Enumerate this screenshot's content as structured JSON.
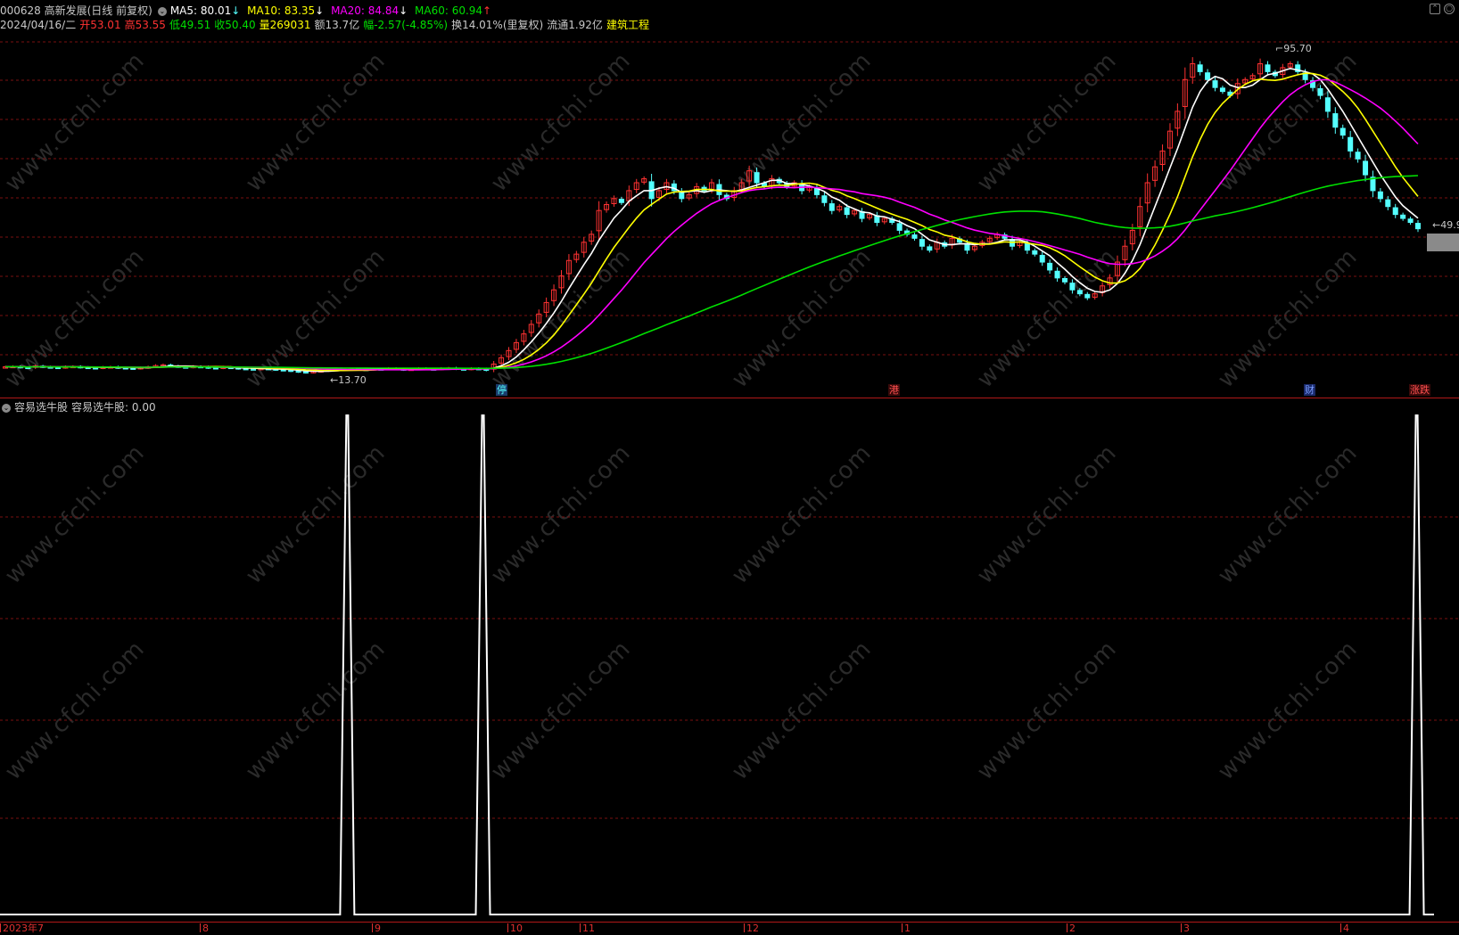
{
  "header": {
    "code_name": "000628 高新发展(日线 前复权)",
    "ma5": "MA5: 80.01",
    "ma10": "MA10: 83.35",
    "ma20": "MA20: 84.84",
    "ma60": "MA60: 60.94",
    "arrow_down": "↓",
    "arrow_up": "↑",
    "date": "2024/04/16/二",
    "open": "开53.01",
    "high": "高53.55",
    "low": "低49.51",
    "close": "收50.40",
    "volume": "量269031",
    "amount": "额13.7亿",
    "change": "幅-2.57(-4.85%)",
    "turnover": "换14.01%(里复权)",
    "float": "流通1.92亿",
    "sector": "建筑工程"
  },
  "price_labels": {
    "high": "95.70",
    "low": "13.70",
    "last": "49.90"
  },
  "event_markers": [
    "停",
    "港",
    "财",
    "涨跌"
  ],
  "indicator": {
    "name": "容易选牛股",
    "value_label": "容易选牛股: 0.00"
  },
  "x_axis": [
    "2023年7",
    "8",
    "9",
    "10",
    "11",
    "12",
    "1",
    "2",
    "3",
    "4"
  ],
  "watermark": "www.cfchi.com",
  "colors": {
    "up": "#ff3232",
    "down": "#54ffff",
    "ma5": "#ffffff",
    "ma10": "#ffff00",
    "ma20": "#ff00ff",
    "ma60": "#00e000",
    "grid": "#7a1010",
    "axis": "#b01818"
  },
  "chart_data": {
    "type": "candlestick",
    "title": "000628 高新发展(日线 前复权)",
    "y_range": [
      13.7,
      95.7
    ],
    "price_high": 95.7,
    "price_low": 13.7,
    "last_price": 49.9,
    "close_series": [
      15.6,
      15.7,
      15.5,
      15.4,
      15.8,
      15.6,
      15.5,
      15.4,
      15.6,
      15.7,
      15.5,
      15.4,
      15.3,
      15.5,
      15.6,
      15.4,
      15.3,
      15.2,
      15.4,
      15.6,
      15.9,
      16.1,
      15.8,
      15.6,
      15.5,
      15.7,
      15.6,
      15.4,
      15.3,
      15.5,
      15.4,
      15.2,
      15.1,
      15.0,
      15.2,
      15.1,
      14.9,
      14.8,
      14.6,
      14.4,
      14.2,
      14.4,
      14.6,
      14.8,
      14.9,
      15.0,
      15.1,
      15.0,
      14.9,
      15.1,
      15.0,
      15.2,
      15.1,
      14.9,
      15.0,
      15.2,
      15.1,
      15.0,
      15.2,
      15.3,
      15.1,
      15.0,
      15.2,
      15.1,
      14.8,
      16.3,
      17.9,
      19.7,
      21.7,
      23.9,
      26.3,
      28.9,
      31.8,
      35.0,
      38.5,
      42.4,
      44.0,
      47.0,
      49.0,
      55.0,
      56.5,
      58.0,
      57.0,
      60.0,
      62.0,
      63.0,
      58.0,
      60.0,
      62.0,
      60.0,
      58.0,
      59.0,
      61.0,
      60.0,
      62.0,
      59.0,
      58.0,
      60.0,
      62.0,
      65.0,
      62.0,
      61.0,
      63.0,
      62.0,
      61.0,
      62.0,
      60.0,
      61.0,
      59.0,
      57.0,
      55.0,
      56.0,
      54.0,
      55.0,
      53.0,
      54.0,
      52.0,
      53.0,
      52.0,
      50.0,
      49.0,
      48.0,
      46.0,
      45.0,
      47.0,
      46.0,
      48.0,
      47.0,
      45.0,
      46.0,
      47.0,
      48.0,
      49.0,
      48.0,
      46.0,
      47.0,
      45.0,
      44.0,
      42.0,
      40.0,
      38.0,
      37.0,
      35.0,
      34.0,
      33.0,
      34.0,
      36.0,
      38.0,
      42.0,
      46.0,
      50.0,
      56.0,
      62.0,
      66.0,
      70.0,
      75.0,
      80.0,
      88.0,
      92.0,
      90.0,
      88.0,
      86.0,
      85.0,
      84.0,
      87.0,
      88.0,
      89.0,
      92.0,
      90.0,
      89.0,
      91.0,
      92.0,
      90.0,
      88.0,
      86.0,
      84.0,
      80.0,
      76.0,
      74.0,
      70.0,
      68.0,
      64.0,
      60.0,
      58.0,
      56.0,
      54.0,
      53.0,
      52.0,
      50.4
    ],
    "ma_last": {
      "MA5": 80.01,
      "MA10": 83.35,
      "MA20": 84.84,
      "MA60": 60.94
    },
    "indicator_signal_positions": [
      0.238,
      0.331,
      0.971
    ],
    "indicator_value": 0.0
  }
}
